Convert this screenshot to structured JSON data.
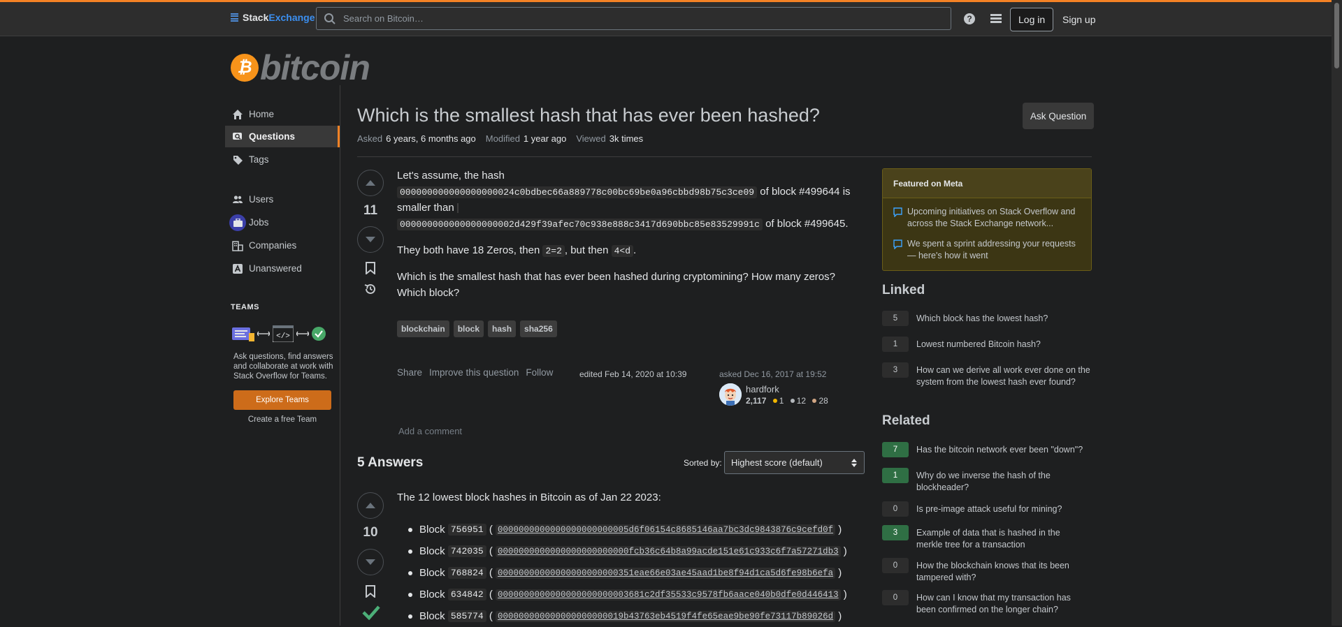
{
  "topbar": {
    "logo_stack": "Stack",
    "logo_exchange": "Exchange",
    "search_placeholder": "Search on Bitcoin…",
    "login": "Log in",
    "signup": "Sign up",
    "icons": [
      "help-icon",
      "site-switcher-icon"
    ]
  },
  "site": {
    "name": "bitcoin",
    "coin_glyph": "₿",
    "brand_color": "#f7931a"
  },
  "nav": {
    "items": [
      {
        "label": "Home",
        "icon": "home-icon"
      },
      {
        "label": "Questions",
        "icon": "questions-icon",
        "active": true
      },
      {
        "label": "Tags",
        "icon": "tag-icon"
      },
      {
        "label": "Users",
        "icon": "users-icon"
      },
      {
        "label": "Jobs",
        "icon": "briefcase-icon"
      },
      {
        "label": "Companies",
        "icon": "building-icon"
      },
      {
        "label": "Unanswered",
        "icon": "unanswered-icon"
      }
    ],
    "teams_heading": "TEAMS",
    "teams_text": "Ask questions, find answers and collaborate at work with Stack Overflow for Teams.",
    "explore_button": "Explore Teams",
    "free_team": "Create a free Team"
  },
  "question": {
    "title": "Which is the smallest hash that has ever been hashed?",
    "ask_button": "Ask Question",
    "asked_label": "Asked",
    "asked_value": "6 years, 6 months ago",
    "modified_label": "Modified",
    "modified_value": "1 year ago",
    "viewed_label": "Viewed",
    "viewed_value": "3k times",
    "votes": "11",
    "p1_a": "Let's assume, the hash",
    "hash1": "000000000000000000024c0bdbec66a889778c00bc69be0a96cbbd98b75c3ce09",
    "p1_b": "of block #499644 is",
    "p1_c": "smaller than",
    "hash2": "000000000000000000002d429f39afec70c938e888c3417d690bbc85e83529991c",
    "p1_d": "of block #499645.",
    "p2_a": "They both have 18 Zeros, then",
    "code_a": "2=2",
    "p2_b": ", but then",
    "code_b": "4<d",
    "p2_c": ".",
    "p3": "Which is the smallest hash that has ever been hashed during cryptomining? How many zeros? Which block?",
    "tags": [
      "blockchain",
      "block",
      "hash",
      "sha256"
    ],
    "menu": [
      "Share",
      "Improve this question",
      "Follow"
    ],
    "edited": "edited Feb 14, 2020 at 10:39",
    "asked_when": "asked Dec 16, 2017 at 19:52",
    "user": {
      "name": "hardfork",
      "rep": "2,117",
      "gold": "1",
      "silver": "12",
      "bronze": "28"
    },
    "add_comment": "Add a comment"
  },
  "answers": {
    "heading": "5 Answers",
    "sorted_label": "Sorted by:",
    "sort_value": "Highest score (default)",
    "first": {
      "votes": "10",
      "intro": "The 12 lowest block hashes in Bitcoin as of Jan 22 2023:",
      "blocks": [
        {
          "num": "756951",
          "hash": "0000000000000000000000005d6f06154c8685146aa7bc3dc9843876c9cefd0f"
        },
        {
          "num": "742035",
          "hash": "0000000000000000000000000fcb36c64b8a99acde151e61c933c6f7a57271db3"
        },
        {
          "num": "768824",
          "hash": "00000000000000000000000351eae66e03ae45aad1be8f94d1ca5d6fe98b6efa"
        },
        {
          "num": "634842",
          "hash": "0000000000000000000000003681c2df35533c9578fb6aace040b0dfe0d446413"
        },
        {
          "num": "585774",
          "hash": "000000000000000000000019b43763eb4519f4fe65eae9be90fe73117b89026d"
        }
      ],
      "block_label": "Block"
    }
  },
  "sidebar": {
    "featured_heading": "Featured on Meta",
    "featured": [
      "Upcoming initiatives on Stack Overflow and across the Stack Exchange network...",
      "We spent a sprint addressing your requests — here's how it went"
    ],
    "linked_heading": "Linked",
    "linked": [
      {
        "score": "5",
        "title": "Which block has the lowest hash?"
      },
      {
        "score": "1",
        "title": "Lowest numbered Bitcoin hash?"
      },
      {
        "score": "3",
        "title": "How can we derive all work ever done on the system from the lowest hash ever found?"
      }
    ],
    "related_heading": "Related",
    "related": [
      {
        "score": "7",
        "title": "Has the bitcoin network ever been \"down\"?",
        "answered": true
      },
      {
        "score": "1",
        "title": "Why do we inverse the hash of the blockheader?",
        "answered": true
      },
      {
        "score": "0",
        "title": "Is pre-image attack useful for mining?",
        "answered": false
      },
      {
        "score": "3",
        "title": "Example of data that is hashed in the merkle tree for a transaction",
        "answered": true
      },
      {
        "score": "0",
        "title": "How the blockchain knows that its been tampered with?",
        "answered": false
      },
      {
        "score": "0",
        "title": "How can I know that my transaction has been confirmed on the longer chain?",
        "answered": false
      }
    ]
  }
}
